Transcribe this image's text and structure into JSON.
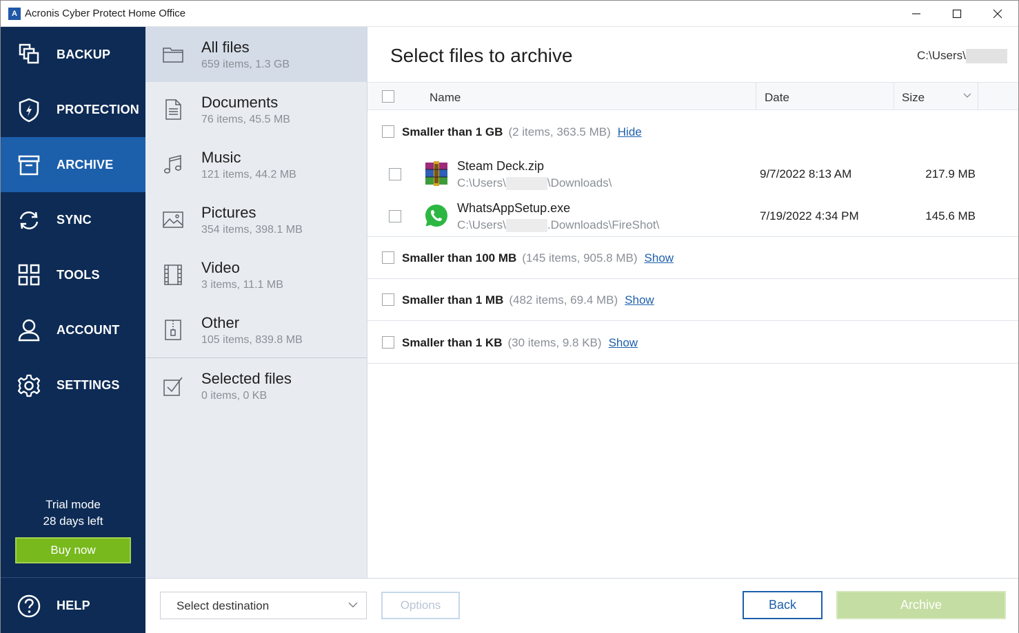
{
  "window": {
    "title": "Acronis Cyber Protect Home Office",
    "app_icon_letter": "A"
  },
  "sidebar": {
    "items": [
      {
        "label": "BACKUP",
        "icon": "backup-icon"
      },
      {
        "label": "PROTECTION",
        "icon": "shield-icon"
      },
      {
        "label": "ARCHIVE",
        "icon": "archive-box-icon",
        "active": true
      },
      {
        "label": "SYNC",
        "icon": "sync-icon"
      },
      {
        "label": "TOOLS",
        "icon": "tools-grid-icon"
      },
      {
        "label": "ACCOUNT",
        "icon": "user-icon"
      },
      {
        "label": "SETTINGS",
        "icon": "gear-icon"
      }
    ],
    "trial_line1": "Trial mode",
    "trial_line2": "28 days left",
    "buy_label": "Buy now",
    "help_label": "HELP"
  },
  "categories": [
    {
      "name": "All files",
      "sub": "659 items, 1.3 GB",
      "icon": "folder-icon",
      "active": true
    },
    {
      "name": "Documents",
      "sub": "76 items, 45.5 MB",
      "icon": "document-icon"
    },
    {
      "name": "Music",
      "sub": "121 items, 44.2 MB",
      "icon": "music-note-icon"
    },
    {
      "name": "Pictures",
      "sub": "354 items, 398.1 MB",
      "icon": "picture-icon"
    },
    {
      "name": "Video",
      "sub": "3 items, 11.1 MB",
      "icon": "film-icon"
    },
    {
      "name": "Other",
      "sub": "105 items, 839.8 MB",
      "icon": "zip-file-icon"
    },
    {
      "name": "Selected files",
      "sub": "0 items, 0 KB",
      "icon": "checked-box-icon"
    }
  ],
  "main": {
    "title": "Select files to archive",
    "path_prefix": "C:\\Users\\",
    "columns": {
      "name": "Name",
      "date": "Date",
      "size": "Size"
    },
    "groups": [
      {
        "label": "Smaller than 1 GB",
        "count": "(2 items, 363.5 MB)",
        "link": "Hide"
      },
      {
        "label": "Smaller than 100 MB",
        "count": "(145 items, 905.8 MB)",
        "link": "Show"
      },
      {
        "label": "Smaller than 1 MB",
        "count": "(482 items, 69.4 MB)",
        "link": "Show"
      },
      {
        "label": "Smaller than 1 KB",
        "count": "(30 items, 9.8 KB)",
        "link": "Show"
      }
    ],
    "files": [
      {
        "name": "Steam Deck.zip",
        "path_prefix": "C:\\Users\\",
        "path_suffix": "\\Downloads\\",
        "date": "9/7/2022 8:13 AM",
        "size": "217.9 MB",
        "icon": "winrar-archive-icon"
      },
      {
        "name": "WhatsAppSetup.exe",
        "path_prefix": "C:\\Users\\",
        "path_suffix": ".Downloads\\FireShot\\",
        "date": "7/19/2022 4:34 PM",
        "size": "145.6 MB",
        "icon": "whatsapp-icon"
      }
    ]
  },
  "footer": {
    "destination_placeholder": "Select destination",
    "options_label": "Options",
    "back_label": "Back",
    "archive_label": "Archive"
  },
  "colors": {
    "sidebar_bg": "#0d2b55",
    "sidebar_active": "#1c5fab",
    "accent_green": "#78b91e",
    "link_blue": "#1c5fab"
  }
}
